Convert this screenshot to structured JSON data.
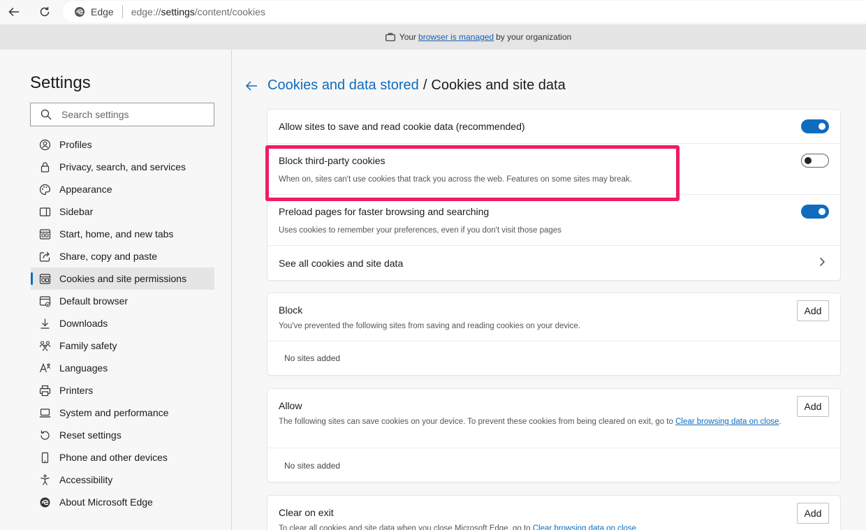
{
  "addressbar": {
    "brand": "Edge",
    "url_prefix": "edge://",
    "url_main": "settings",
    "url_suffix": "/content/cookies"
  },
  "managed": {
    "text_before": "Your",
    "link": "browser is managed",
    "text_after": "by your organization"
  },
  "sidebar": {
    "title": "Settings",
    "search_placeholder": "Search settings",
    "items": [
      {
        "label": "Profiles",
        "icon": "profile-icon"
      },
      {
        "label": "Privacy, search, and services",
        "icon": "lock-icon"
      },
      {
        "label": "Appearance",
        "icon": "palette-icon"
      },
      {
        "label": "Sidebar",
        "icon": "sidebar-icon"
      },
      {
        "label": "Start, home, and new tabs",
        "icon": "home-tabs-icon"
      },
      {
        "label": "Share, copy and paste",
        "icon": "share-icon"
      },
      {
        "label": "Cookies and site permissions",
        "icon": "cookies-icon",
        "active": true
      },
      {
        "label": "Default browser",
        "icon": "default-browser-icon"
      },
      {
        "label": "Downloads",
        "icon": "download-icon"
      },
      {
        "label": "Family safety",
        "icon": "family-icon"
      },
      {
        "label": "Languages",
        "icon": "languages-icon"
      },
      {
        "label": "Printers",
        "icon": "printer-icon"
      },
      {
        "label": "System and performance",
        "icon": "laptop-icon"
      },
      {
        "label": "Reset settings",
        "icon": "reset-icon"
      },
      {
        "label": "Phone and other devices",
        "icon": "phone-icon"
      },
      {
        "label": "Accessibility",
        "icon": "accessibility-icon"
      },
      {
        "label": "About Microsoft Edge",
        "icon": "edge-logo-icon"
      }
    ]
  },
  "main": {
    "breadcrumb": "Cookies and data stored",
    "separator": "/",
    "title": "Cookies and site data",
    "settings": [
      {
        "title": "Allow sites to save and read cookie data (recommended)",
        "desc": "",
        "toggle": "on"
      },
      {
        "title": "Block third-party cookies",
        "desc": "When on, sites can't use cookies that track you across the web. Features on some sites may break.",
        "toggle": "off"
      },
      {
        "title": "Preload pages for faster browsing and searching",
        "desc": "Uses cookies to remember your preferences, even if you don't visit those pages",
        "toggle": "on"
      },
      {
        "title": "See all cookies and site data",
        "desc": ""
      }
    ],
    "block": {
      "title": "Block",
      "add": "Add",
      "desc": "You've prevented the following sites from saving and reading cookies on your device.",
      "empty": "No sites added"
    },
    "allow": {
      "title": "Allow",
      "add": "Add",
      "desc": "The following sites can save cookies on your device. To prevent these cookies from being cleared on exit, go to",
      "link": "Clear browsing data on close",
      "period": ".",
      "empty": "No sites added"
    },
    "clear": {
      "title": "Clear on exit",
      "add": "Add",
      "desc": "To clear all cookies and site data when you close Microsoft Edge, go to",
      "link": "Clear browsing data on close"
    }
  },
  "colors": {
    "accent": "#0f6cbd",
    "highlight": "#ee1d63"
  }
}
